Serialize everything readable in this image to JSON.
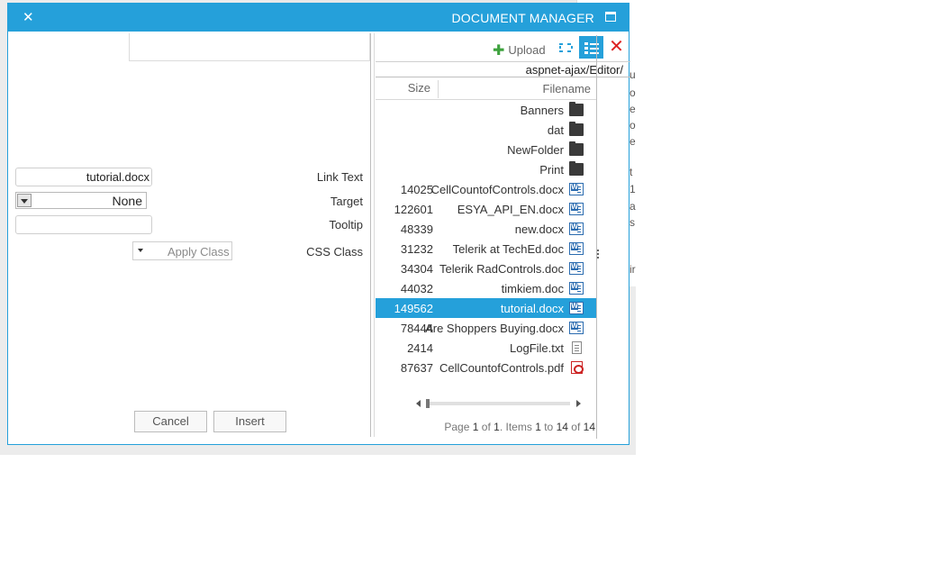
{
  "dialog": {
    "title": "DOCUMENT MANAGER",
    "close_icon": "close-icon",
    "maximize_icon": "maximize-icon",
    "accent_color": "#25a0da"
  },
  "link_form": {
    "link_text": {
      "label": "Link Text",
      "value": "tutorial.docx"
    },
    "target": {
      "label": "Target",
      "value": "None"
    },
    "tooltip": {
      "label": "Tooltip",
      "value": ""
    },
    "css_class": {
      "label": "CSS Class",
      "value": "Apply Class"
    },
    "cancel_label": "Cancel",
    "insert_label": "Insert"
  },
  "file_manager": {
    "toolbar": {
      "upload_label": "Upload",
      "upload_icon": "plus-icon",
      "thumbnails_icon": "thumbnails-view-icon",
      "list_icon": "list-view-icon",
      "delete_icon": "delete-icon"
    },
    "path": "aspnet-ajax/Editor/",
    "columns": {
      "size": "Size",
      "filename": "Filename"
    },
    "rows": [
      {
        "size": "",
        "name": "Banners",
        "icon": "folder-icon"
      },
      {
        "size": "",
        "name": "dat",
        "icon": "folder-icon"
      },
      {
        "size": "",
        "name": "NewFolder",
        "icon": "folder-icon"
      },
      {
        "size": "",
        "name": "Print",
        "icon": "folder-icon"
      },
      {
        "size": "14025",
        "name": "CellCountofControls.docx",
        "icon": "word-icon"
      },
      {
        "size": "122601",
        "name": "ESYA_API_EN.docx",
        "icon": "word-icon"
      },
      {
        "size": "48339",
        "name": "new.docx",
        "icon": "word-icon"
      },
      {
        "size": "31232",
        "name": "Telerik at TechEd.doc",
        "icon": "word-icon"
      },
      {
        "size": "34304",
        "name": "Telerik RadControls.doc",
        "icon": "word-icon"
      },
      {
        "size": "44032",
        "name": "timkiem.doc",
        "icon": "word-icon"
      },
      {
        "size": "149562",
        "name": "tutorial.docx",
        "icon": "word-icon",
        "selected": true
      },
      {
        "size": "78444",
        "name": "Are Shoppers Buying.docx",
        "icon": "word-icon"
      },
      {
        "size": "2414",
        "name": "LogFile.txt",
        "icon": "text-file-icon"
      },
      {
        "size": "87637",
        "name": "CellCountofControls.pdf",
        "icon": "pdf-icon"
      }
    ],
    "pager": {
      "page_word": "Page",
      "page": "1",
      "of_word": "of",
      "page_count": "1",
      "items_word": ". Items",
      "from": "1",
      "to_word": "to",
      "to": "14",
      "of_word2": "of",
      "total": "14"
    }
  },
  "background_editor_fragments": [
    "u",
    "o",
    "es",
    "o",
    "e",
    "t",
    "1",
    "a",
    "s",
    "ir"
  ]
}
